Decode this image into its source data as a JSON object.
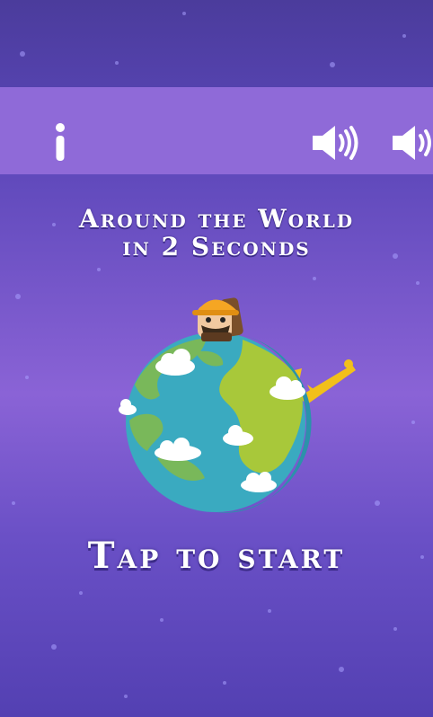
{
  "game": {
    "title_line1": "Around the World",
    "title_line2": "in 2 Seconds",
    "start_prompt": "Tap to start"
  },
  "toolbar": {
    "info_icon": "info-icon",
    "sound_icon": "speaker-sound-icon"
  },
  "colors": {
    "background": "#5a46b8",
    "bar": "#8f6ad8",
    "ocean": "#3aaac0",
    "land": "#a8c83a",
    "tower": "#f2c01a"
  }
}
